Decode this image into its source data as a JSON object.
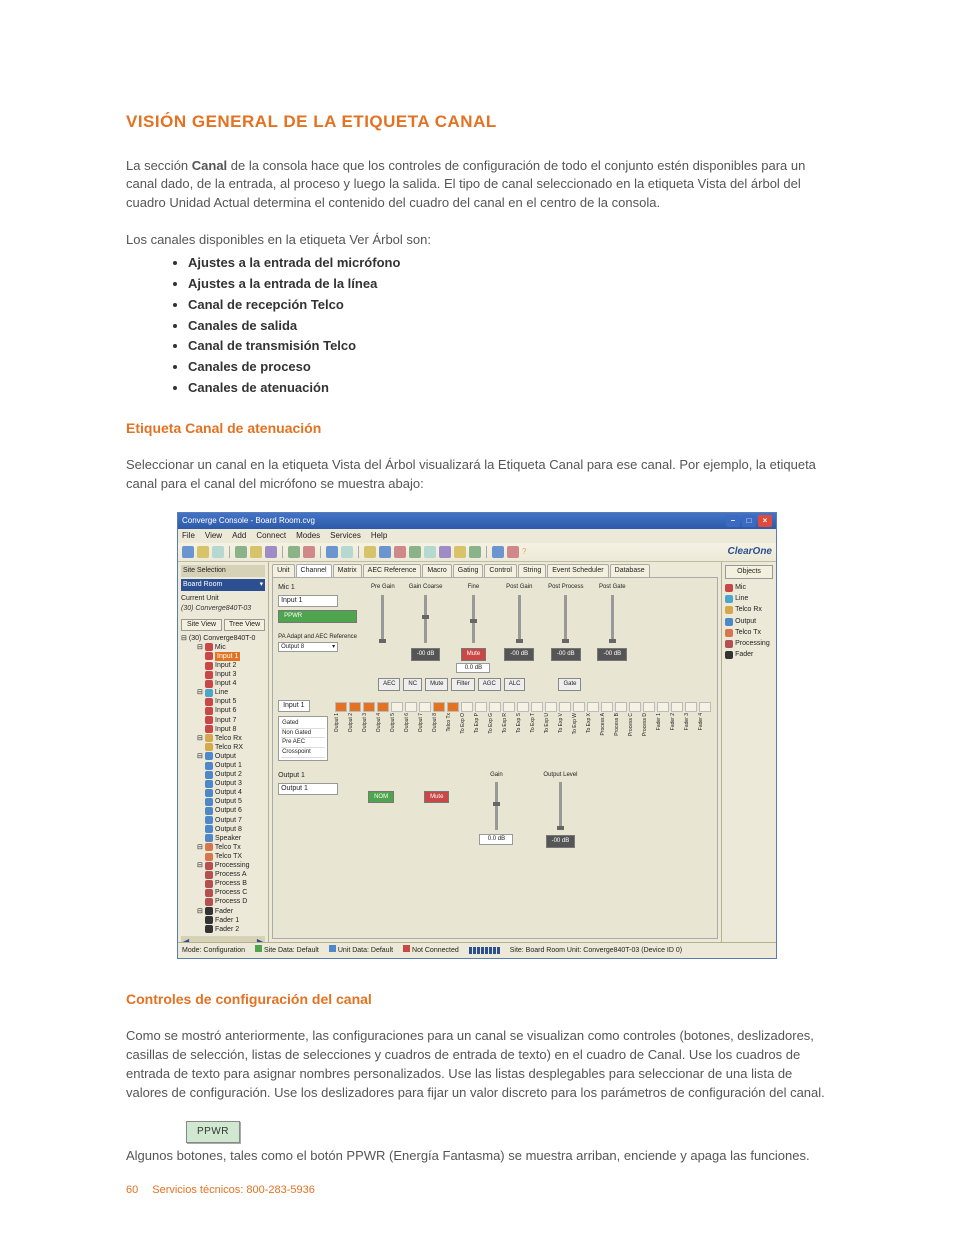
{
  "heading": "VISIÓN GENERAL DE LA ETIQUETA CANAL",
  "intro_pre": "La sección ",
  "intro_bold": "Canal",
  "intro_post": " de la consola hace que los controles de configuración de todo el conjunto estén disponibles para un canal dado, de la entrada, al proceso y luego la salida. El tipo de canal seleccionado en la etiqueta Vista del árbol del cuadro Unidad Actual determina el contenido del cuadro del canal en el centro de la consola.",
  "avail_lead": "Los canales disponibles en la etiqueta Ver Árbol son:",
  "bullets": {
    "b0": "Ajustes a la entrada del micrófono",
    "b1": "Ajustes a la entrada de la línea",
    "b2": "Canal de recepción Telco",
    "b3": "Canales de salida",
    "b4": "Canal de transmisión Telco",
    "b5": "Canales de proceso",
    "b6": "Canales de atenuación"
  },
  "subhead1": "Etiqueta Canal de atenuación",
  "sub1_body": "Seleccionar un canal en la etiqueta Vista del Árbol visualizará la Etiqueta Canal para ese canal. Por ejemplo, la etiqueta canal para el canal del micrófono se muestra abajo:",
  "subhead2": "Controles de configuración del canal",
  "sub2_body": "Como se mostró anteriormente, las configuraciones para un canal se visualizan como controles (botones, deslizadores, casillas de selección, listas de selecciones y cuadros de entrada de texto) en el cuadro de Canal. Use los cuadros de entrada de texto para asignar nombres personalizados. Use las listas desplegables para seleccionar de una lista de valores de configuración. Use los deslizadores para fijar un valor discreto para los parámetros de configuración del canal.",
  "ppwr_label": "PPWR",
  "ppwr_note": "Algunos botones, tales como el botón PPWR (Energía Fantasma) se muestra arriban, enciende y apaga las funciones.",
  "footer": {
    "page": "60",
    "service": "Servicios técnicos: 800-283-5936"
  },
  "app": {
    "title": "Converge Console - Board Room.cvg",
    "menus": {
      "m0": "File",
      "m1": "View",
      "m2": "Add",
      "m3": "Connect",
      "m4": "Modes",
      "m5": "Services",
      "m6": "Help"
    },
    "brand": "ClearOne",
    "left": {
      "site_selection_label": "Site Selection",
      "site_name": "Board Room",
      "current_unit_label": "Current Unit",
      "current_unit": "(30) Converge840T-03",
      "site_view": "Site View",
      "tree_view": "Tree View",
      "tree": {
        "root": "(30) Converge840T-0",
        "mic": "Mic",
        "input1": "Input 1",
        "input2": "Input 2",
        "input3": "Input 3",
        "input4": "Input 4",
        "line": "Line",
        "input5": "Input 5",
        "input6": "Input 6",
        "input7": "Input 7",
        "input8": "Input 8",
        "telcorx": "Telco Rx",
        "telcorxn": "Telco RX",
        "output": "Output",
        "o1": "Output 1",
        "o2": "Output 2",
        "o3": "Output 3",
        "o4": "Output 4",
        "o5": "Output 5",
        "o6": "Output 6",
        "o7": "Output 7",
        "o8": "Output 8",
        "spk": "Speaker",
        "telcotx": "Telco Tx",
        "telcotxn": "Telco TX",
        "proc": "Processing",
        "pa": "Process A",
        "pb": "Process B",
        "pc": "Process C",
        "pd": "Process D",
        "fader": "Fader",
        "f1": "Fader 1",
        "f2": "Fader 2"
      }
    },
    "tabs": {
      "t0": "Unit",
      "t1": "Channel",
      "t2": "Matrix",
      "t3": "AEC Reference",
      "t4": "Macro",
      "t5": "Gating",
      "t6": "Control",
      "t7": "String",
      "t8": "Event Scheduler",
      "t9": "Database"
    },
    "signal": {
      "mic_label": "Mic 1",
      "input_box": "Input 1",
      "pre_gain": "Pre Gain",
      "gain_coarse": "Gain Coarse",
      "fine": "Fine",
      "post_gain": "Post Gain",
      "post_process": "Post Process",
      "post_gate": "Post Gate",
      "ppwr": "PPWR",
      "mute": "Mute",
      "db_btn": "-00 dB",
      "val_box": "0.0 dB",
      "pa_ref": "PA Adapt and AEC Reference",
      "pa_val": "Output 8",
      "proc_btns": {
        "aec": "AEC",
        "nc": "NC",
        "mute": "Mute",
        "filter": "Filter",
        "agc": "AGC",
        "alc": "ALC",
        "gate": "Gate"
      },
      "matrix_input": "Input 1",
      "cols": {
        "c0": "1",
        "c1": "2",
        "c2": "3",
        "c3": "4",
        "c4": "5",
        "c5": "6",
        "c6": "7",
        "c7": "8",
        "c8": "1",
        "c9": "T",
        "c10": "O",
        "c11": "P",
        "c12": "G",
        "c13": "R",
        "c14": "S",
        "c15": "T",
        "c16": "U",
        "c17": "V",
        "c18": "W",
        "c19": "X",
        "c20": "1",
        "c21": "2",
        "c22": "3",
        "c23": "4",
        "c24": "A",
        "c25": "B",
        "c26": "C",
        "c27": "D",
        "c28": "1",
        "c29": "2",
        "c30": "3",
        "c31": "4"
      },
      "col_rot": {
        "r0": "Output 1",
        "r1": "Output 2",
        "r2": "Output 3",
        "r3": "Output 4",
        "r4": "Output 5",
        "r5": "Output 6",
        "r6": "Output 7",
        "r7": "Output 8",
        "r8": "Telco Tx",
        "r9": "To Exp O",
        "r10": "To Exp P",
        "r11": "To Exp G",
        "r12": "To Exp R",
        "r13": "To Exp S",
        "r14": "To Exp T",
        "r15": "To Exp U",
        "r16": "To Exp V",
        "r17": "To Exp W",
        "r18": "To Exp X",
        "r19": "Process A",
        "r20": "Process B",
        "r21": "Process C",
        "r22": "Process D",
        "r23": "Fader 1",
        "r24": "Fader 2",
        "r25": "Fader 3",
        "r26": "Fader 4"
      },
      "gate_opts": {
        "g0": "Gated",
        "g1": "Non Gated",
        "g2": "Pre AEC",
        "g3": "Crosspoint"
      },
      "out_label": "Output 1",
      "out_box": "Output 1",
      "nom": "NOM",
      "out_mute": "Mute",
      "gain": "Gain",
      "out_level": "Output Level"
    },
    "right": {
      "objects": "Objects",
      "mic": "Mic",
      "line": "Line",
      "telcorx": "Telco Rx",
      "output": "Output",
      "telcotx": "Telco Tx",
      "processing": "Processing",
      "fader": "Fader"
    },
    "status": {
      "mode": "Mode: Configuration",
      "site_data": "Site Data: Default",
      "unit_data": "Unit Data: Default",
      "conn": "Not Connected",
      "loc": "Site: Board Room   Unit: Converge840T-03 (Device ID 0)"
    }
  }
}
